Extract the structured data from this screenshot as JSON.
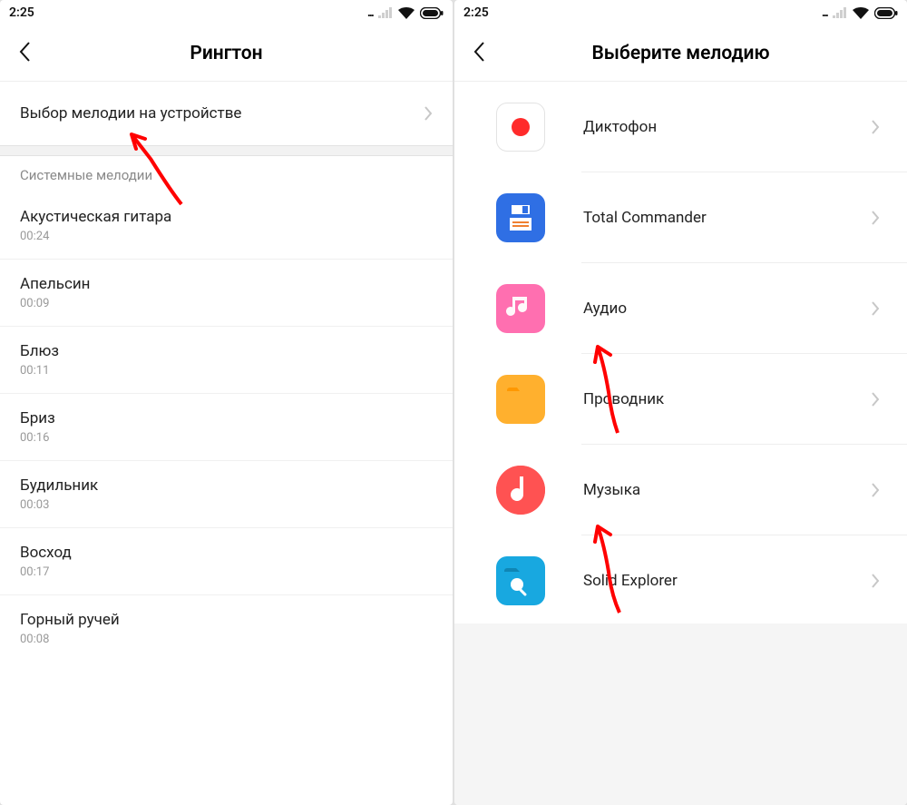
{
  "status_time": "2:25",
  "left": {
    "title": "Рингтон",
    "top_row": "Выбор мелодии на устройстве",
    "section": "Системные мелодии",
    "songs": [
      {
        "name": "Акустическая гитара",
        "duration": "00:24"
      },
      {
        "name": "Апельсин",
        "duration": "00:09"
      },
      {
        "name": "Блюз",
        "duration": "00:11"
      },
      {
        "name": "Бриз",
        "duration": "00:16"
      },
      {
        "name": "Будильник",
        "duration": "00:03"
      },
      {
        "name": "Восход",
        "duration": "00:17"
      },
      {
        "name": "Горный ручей",
        "duration": "00:08"
      }
    ]
  },
  "right": {
    "title": "Выберите мелодию",
    "apps": [
      {
        "id": "record",
        "label": "Диктофон"
      },
      {
        "id": "floppy",
        "label": "Total Commander"
      },
      {
        "id": "audio",
        "label": "Аудио"
      },
      {
        "id": "folder",
        "label": "Проводник"
      },
      {
        "id": "music",
        "label": "Музыка"
      },
      {
        "id": "solid",
        "label": "Solid Explorer"
      }
    ]
  }
}
